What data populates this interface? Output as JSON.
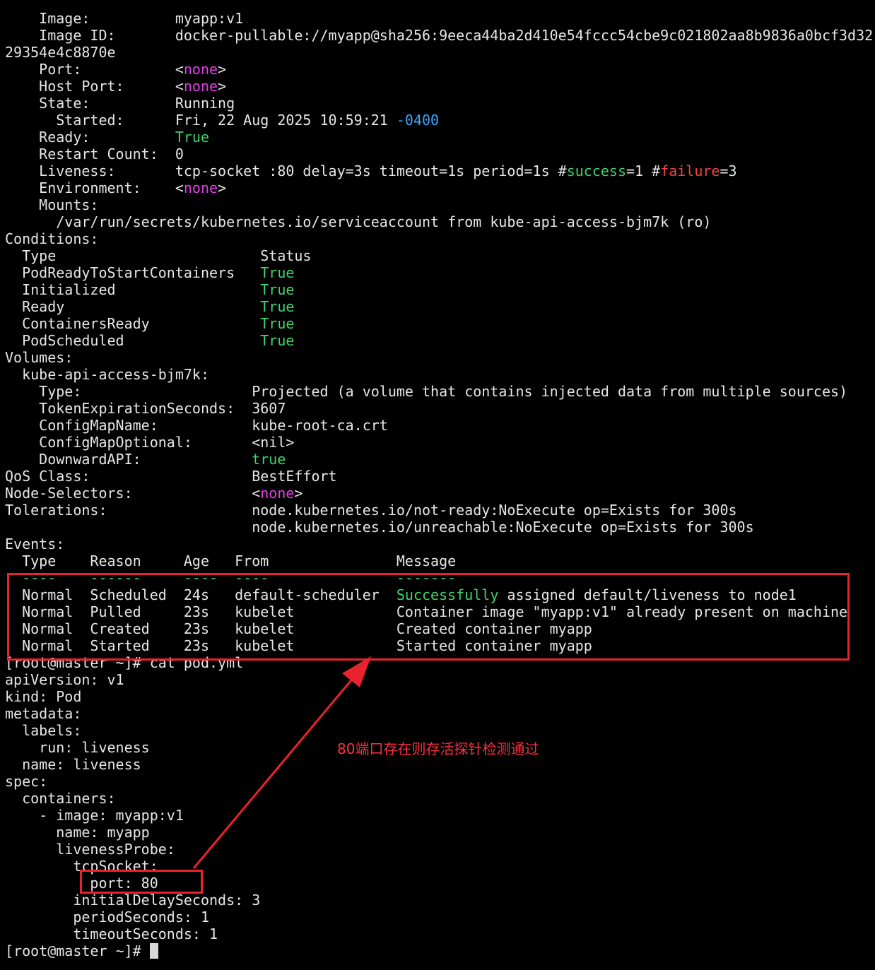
{
  "terminal": {
    "lines": [
      [
        {
          "t": "    Image:          myapp:v1"
        }
      ],
      [
        {
          "t": "    Image ID:       docker-pullable://myapp@sha256:9eeca44ba2d410e54fccc54cbe9c021802aa8b9836a0bcf3d32"
        }
      ],
      [
        {
          "t": "29354e4c8870e"
        }
      ],
      [
        {
          "t": "    Port:           <"
        },
        {
          "t": "none",
          "c": "magenta"
        },
        {
          "t": ">"
        }
      ],
      [
        {
          "t": "    Host Port:      <"
        },
        {
          "t": "none",
          "c": "magenta"
        },
        {
          "t": ">"
        }
      ],
      [
        {
          "t": "    State:          Running"
        }
      ],
      [
        {
          "t": "      Started:      Fri, 22 Aug 2025 10:59:21 "
        },
        {
          "t": "-0400",
          "c": "blue"
        }
      ],
      [
        {
          "t": "    Ready:          "
        },
        {
          "t": "True",
          "c": "green"
        }
      ],
      [
        {
          "t": "    Restart Count:  0"
        }
      ],
      [
        {
          "t": "    Liveness:       tcp-socket :80 delay=3s timeout=1s period=1s #"
        },
        {
          "t": "success",
          "c": "green"
        },
        {
          "t": "=1 #"
        },
        {
          "t": "failure",
          "c": "red"
        },
        {
          "t": "=3"
        }
      ],
      [
        {
          "t": "    Environment:    <"
        },
        {
          "t": "none",
          "c": "magenta"
        },
        {
          "t": ">"
        }
      ],
      [
        {
          "t": "    Mounts:"
        }
      ],
      [
        {
          "t": "      /var/run/secrets/kubernetes.io/serviceaccount from kube-api-access-bjm7k (ro)"
        }
      ],
      [
        {
          "t": "Conditions:"
        }
      ],
      [
        {
          "t": "  Type                        Status"
        }
      ],
      [
        {
          "t": "  PodReadyToStartContainers   "
        },
        {
          "t": "True",
          "c": "green"
        }
      ],
      [
        {
          "t": "  Initialized                 "
        },
        {
          "t": "True",
          "c": "green"
        }
      ],
      [
        {
          "t": "  Ready                       "
        },
        {
          "t": "True",
          "c": "green"
        }
      ],
      [
        {
          "t": "  ContainersReady             "
        },
        {
          "t": "True",
          "c": "green"
        }
      ],
      [
        {
          "t": "  PodScheduled                "
        },
        {
          "t": "True",
          "c": "green"
        }
      ],
      [
        {
          "t": "Volumes:"
        }
      ],
      [
        {
          "t": "  kube-api-access-bjm7k:"
        }
      ],
      [
        {
          "t": "    Type:                    Projected (a volume that contains injected data from multiple sources)"
        }
      ],
      [
        {
          "t": "    TokenExpirationSeconds:  3607"
        }
      ],
      [
        {
          "t": "    ConfigMapName:           kube-root-ca.crt"
        }
      ],
      [
        {
          "t": "    ConfigMapOptional:       <nil>"
        }
      ],
      [
        {
          "t": "    DownwardAPI:             "
        },
        {
          "t": "true",
          "c": "green"
        }
      ],
      [
        {
          "t": "QoS Class:                   BestEffort"
        }
      ],
      [
        {
          "t": "Node-Selectors:              <"
        },
        {
          "t": "none",
          "c": "magenta"
        },
        {
          "t": ">"
        }
      ],
      [
        {
          "t": "Tolerations:                 node.kubernetes.io/not-ready:NoExecute op=Exists for 300s"
        }
      ],
      [
        {
          "t": "                             node.kubernetes.io/unreachable:NoExecute op=Exists for 300s"
        }
      ],
      [
        {
          "t": "Events:"
        }
      ],
      [
        {
          "t": "  Type    Reason     Age   From               Message"
        }
      ],
      [
        {
          "t": "  ----    ------     ----  ----               -------",
          "c": "green"
        }
      ],
      [
        {
          "t": "  Normal  Scheduled  24s   default-scheduler  "
        },
        {
          "t": "Successfully",
          "c": "green"
        },
        {
          "t": " assigned default/liveness to node1"
        }
      ],
      [
        {
          "t": "  Normal  Pulled     23s   kubelet            Container image \"myapp:v1\" already present on machine"
        }
      ],
      [
        {
          "t": "  Normal  Created    23s   kubelet            Created container myapp"
        }
      ],
      [
        {
          "t": "  Normal  Started    23s   kubelet            Started container myapp"
        }
      ],
      [
        {
          "t": "[root@master ~]# cat pod.yml"
        }
      ],
      [
        {
          "t": "apiVersion: v1"
        }
      ],
      [
        {
          "t": "kind: Pod"
        }
      ],
      [
        {
          "t": "metadata:"
        }
      ],
      [
        {
          "t": "  labels:"
        }
      ],
      [
        {
          "t": "    run: liveness"
        }
      ],
      [
        {
          "t": "  name: liveness"
        }
      ],
      [
        {
          "t": "spec:"
        }
      ],
      [
        {
          "t": "  containers:"
        }
      ],
      [
        {
          "t": "    - image: myapp:v1"
        }
      ],
      [
        {
          "t": "      name: myapp"
        }
      ],
      [
        {
          "t": "      livenessProbe:"
        }
      ],
      [
        {
          "t": "        tcpSocket:"
        }
      ],
      [
        {
          "t": "          port: 80"
        }
      ],
      [
        {
          "t": "        initialDelaySeconds: 3"
        }
      ],
      [
        {
          "t": "        periodSeconds: 1"
        }
      ],
      [
        {
          "t": "        timeoutSeconds: 1"
        }
      ],
      [
        {
          "t": "[root@master ~]# "
        }
      ]
    ]
  },
  "annotation": {
    "text": "80端口存在则存活探针检测通过",
    "color": "#ff2f3f"
  },
  "colors": {
    "background": "#000000",
    "foreground": "#e6e6e6",
    "green": "#3fd36b",
    "magenta": "#e23ee6",
    "red": "#f2443f",
    "blue": "#3aa6ff",
    "annotation_red": "#e8232e"
  }
}
